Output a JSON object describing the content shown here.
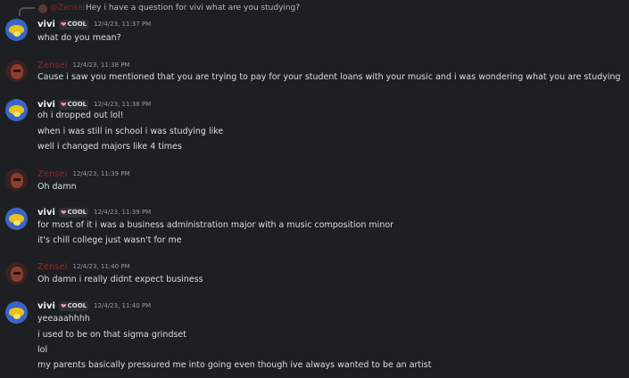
{
  "reply": {
    "author": "@Zensei",
    "text": "Hey i have a question for vivi what are you studying?"
  },
  "messages": [
    {
      "author": "vivi",
      "tag": "COOL",
      "timestamp": "12/4/23, 11:37 PM",
      "lines": [
        "what do you mean?"
      ]
    },
    {
      "author": "Zensei",
      "timestamp": "12/4/23, 11:38 PM",
      "lines": [
        "Cause i saw you mentioned that you are trying to pay for your student loans with your music and i was wondering what you are studying"
      ]
    },
    {
      "author": "vivi",
      "tag": "COOL",
      "timestamp": "12/4/23, 11:38 PM",
      "lines": [
        "oh i dropped out lol!",
        "when i was still in school i was studying like",
        "well i changed majors like 4 times"
      ]
    },
    {
      "author": "Zensei",
      "timestamp": "12/4/23, 11:39 PM",
      "lines": [
        "Oh damn"
      ]
    },
    {
      "author": "vivi",
      "tag": "COOL",
      "timestamp": "12/4/23, 11:39 PM",
      "lines": [
        "for most of it i was a business administration major with a music composition minor",
        "it's chill college just wasn't for me"
      ]
    },
    {
      "author": "Zensei",
      "timestamp": "12/4/23, 11:40 PM",
      "lines": [
        "Oh damn i really didnt expect business"
      ]
    },
    {
      "author": "vivi",
      "tag": "COOL",
      "timestamp": "12/4/23, 11:40 PM",
      "lines": [
        "yeeaaahhhh",
        "i used to be on that sigma grindset",
        "lol",
        "my parents basically pressured me into going even though ive always wanted to be an artist"
      ]
    }
  ]
}
